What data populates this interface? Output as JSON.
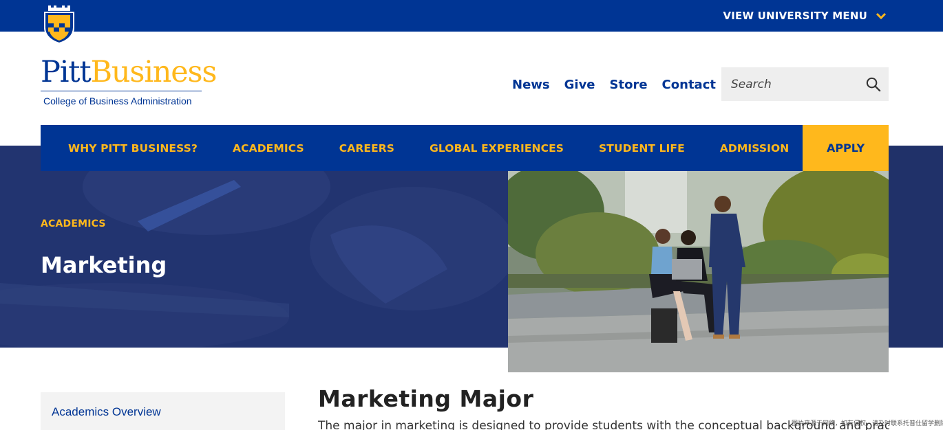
{
  "header": {
    "university_menu_label": "VIEW UNIVERSITY MENU",
    "logo": {
      "word_part1": "Pitt",
      "word_part2": "Business",
      "subtitle": "College of Business Administration"
    },
    "utility_links": [
      "News",
      "Give",
      "Store",
      "Contact"
    ],
    "search": {
      "placeholder": "Search",
      "icon": "search-icon"
    }
  },
  "main_nav": {
    "items": [
      "WHY PITT BUSINESS?",
      "ACADEMICS",
      "CAREERS",
      "GLOBAL EXPERIENCES",
      "STUDENT LIFE",
      "ADMISSION"
    ],
    "apply_label": "APPLY"
  },
  "hero": {
    "eyebrow": "ACADEMICS",
    "title": "Marketing"
  },
  "sidebar": {
    "items": [
      "Academics Overview"
    ]
  },
  "content": {
    "title": "Marketing Major",
    "intro": "The major in marketing is designed to provide students with the conceptual background and practical skills"
  },
  "watermark": "图片来源于网络，如有侵权，请及时联系托普仕留学删除",
  "colors": {
    "pitt_blue": "#003594",
    "pitt_gold": "#ffb81c",
    "hero_navy": "#203169"
  }
}
